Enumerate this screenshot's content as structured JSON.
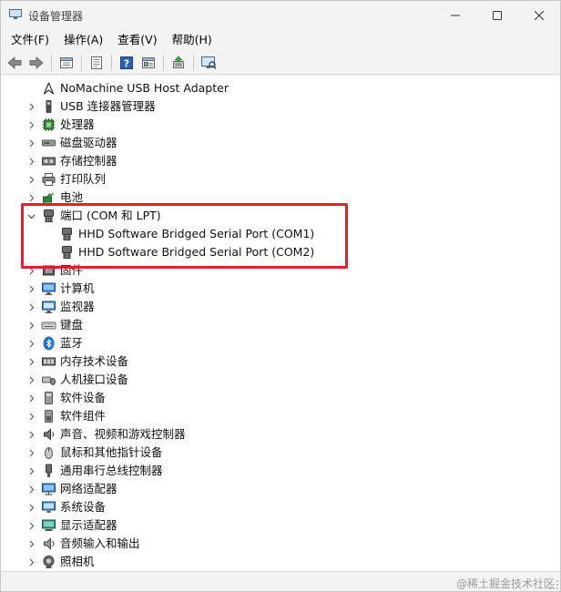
{
  "window": {
    "title": "设备管理器"
  },
  "menu": [
    {
      "label": "文件(F)",
      "name": "menu-file"
    },
    {
      "label": "操作(A)",
      "name": "menu-action"
    },
    {
      "label": "查看(V)",
      "name": "menu-view"
    },
    {
      "label": "帮助(H)",
      "name": "menu-help"
    }
  ],
  "toolbar": [
    {
      "icon": "back-arrow-icon",
      "name": "back-button"
    },
    {
      "icon": "forward-arrow-icon",
      "name": "forward-button"
    },
    {
      "icon": "properties-icon",
      "name": "properties-button"
    },
    {
      "icon": "view-icon",
      "name": "view-button"
    },
    {
      "icon": "help-icon",
      "name": "help-button"
    },
    {
      "icon": "list-icon",
      "name": "list-button"
    },
    {
      "icon": "update-driver-icon",
      "name": "update-driver-button"
    },
    {
      "icon": "scan-hardware-icon",
      "name": "scan-hardware-button"
    }
  ],
  "tree": {
    "items": [
      {
        "label": "NoMachine USB Host Adapter",
        "icon": "nomachine-icon",
        "expander": "",
        "level": 0
      },
      {
        "label": "USB 连接器管理器",
        "icon": "usb-connector-icon",
        "expander": "collapsed",
        "level": 0
      },
      {
        "label": "处理器",
        "icon": "processor-icon",
        "expander": "collapsed",
        "level": 0
      },
      {
        "label": "磁盘驱动器",
        "icon": "disk-drive-icon",
        "expander": "collapsed",
        "level": 0
      },
      {
        "label": "存储控制器",
        "icon": "storage-controller-icon",
        "expander": "collapsed",
        "level": 0
      },
      {
        "label": "打印队列",
        "icon": "printer-icon",
        "expander": "collapsed",
        "level": 0
      },
      {
        "label": "电池",
        "icon": "battery-icon",
        "expander": "collapsed",
        "level": 0
      },
      {
        "label": "端口 (COM 和 LPT)",
        "icon": "port-icon",
        "expander": "expanded",
        "level": 0
      },
      {
        "label": "HHD Software Bridged Serial Port (COM1)",
        "icon": "port-icon",
        "expander": "",
        "level": 1
      },
      {
        "label": "HHD Software Bridged Serial Port (COM2)",
        "icon": "port-icon",
        "expander": "",
        "level": 1
      },
      {
        "label": "固件",
        "icon": "firmware-icon",
        "expander": "collapsed",
        "level": 0
      },
      {
        "label": "计算机",
        "icon": "computer-icon",
        "expander": "collapsed",
        "level": 0
      },
      {
        "label": "监视器",
        "icon": "monitor-icon",
        "expander": "collapsed",
        "level": 0
      },
      {
        "label": "键盘",
        "icon": "keyboard-icon",
        "expander": "collapsed",
        "level": 0
      },
      {
        "label": "蓝牙",
        "icon": "bluetooth-icon",
        "expander": "collapsed",
        "level": 0
      },
      {
        "label": "内存技术设备",
        "icon": "memory-device-icon",
        "expander": "collapsed",
        "level": 0
      },
      {
        "label": "人机接口设备",
        "icon": "hid-icon",
        "expander": "collapsed",
        "level": 0
      },
      {
        "label": "软件设备",
        "icon": "software-device-icon",
        "expander": "collapsed",
        "level": 0
      },
      {
        "label": "软件组件",
        "icon": "software-component-icon",
        "expander": "collapsed",
        "level": 0
      },
      {
        "label": "声音、视频和游戏控制器",
        "icon": "sound-icon",
        "expander": "collapsed",
        "level": 0
      },
      {
        "label": "鼠标和其他指针设备",
        "icon": "mouse-icon",
        "expander": "collapsed",
        "level": 0
      },
      {
        "label": "通用串行总线控制器",
        "icon": "usb-controller-icon",
        "expander": "collapsed",
        "level": 0
      },
      {
        "label": "网络适配器",
        "icon": "network-adapter-icon",
        "expander": "collapsed",
        "level": 0
      },
      {
        "label": "系统设备",
        "icon": "system-device-icon",
        "expander": "collapsed",
        "level": 0
      },
      {
        "label": "显示适配器",
        "icon": "display-adapter-icon",
        "expander": "collapsed",
        "level": 0
      },
      {
        "label": "音频输入和输出",
        "icon": "audio-io-icon",
        "expander": "collapsed",
        "level": 0
      },
      {
        "label": "照相机",
        "icon": "camera-icon",
        "expander": "collapsed",
        "level": 0
      }
    ]
  },
  "watermark": "@稀土掘金技术社区",
  "colors": {
    "highlight": "#e0202c",
    "chrome": "#f3f3f3",
    "tree_bg": "#ffffff"
  }
}
